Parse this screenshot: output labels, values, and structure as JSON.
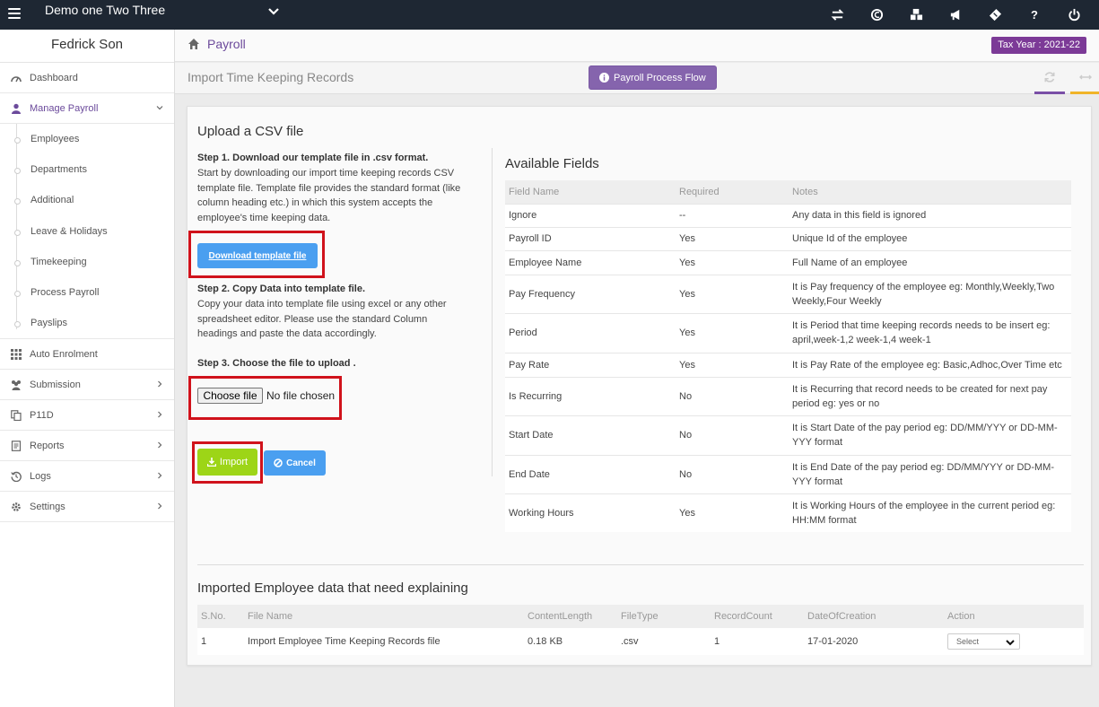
{
  "app": {
    "company": "Demo one Two Three"
  },
  "sidebar": {
    "user": "Fedrick Son",
    "items": [
      {
        "label": "Dashboard",
        "icon": "dashboard-icon"
      },
      {
        "label": "Manage Payroll",
        "icon": "user-icon"
      },
      {
        "label": "Auto Enrolment",
        "icon": "grid-icon"
      },
      {
        "label": "Submission",
        "icon": "users-icon"
      },
      {
        "label": "P11D",
        "icon": "copy-icon"
      },
      {
        "label": "Reports",
        "icon": "report-icon"
      },
      {
        "label": "Logs",
        "icon": "history-icon"
      },
      {
        "label": "Settings",
        "icon": "gear-icon"
      }
    ],
    "sub_items": [
      "Employees",
      "Departments",
      "Additional",
      "Leave & Holidays",
      "Timekeeping",
      "Process Payroll",
      "Payslips"
    ]
  },
  "header": {
    "breadcrumb": "Payroll",
    "tax_year": "Tax Year : 2021-22",
    "page_title": "Import Time Keeping Records",
    "flow_button": "Payroll Process Flow"
  },
  "upload": {
    "title": "Upload a CSV file",
    "step1_title": "Step 1. Download our template file in .csv format.",
    "step1_text": "Start by downloading our import time keeping records CSV template file. Template file provides the standard format (like column heading etc.) in which this system accepts the employee's time keeping data.",
    "download_button": "Download template file",
    "step2_title": "Step 2. Copy Data into template file.",
    "step2_text": "Copy your data into template file using excel or any other spreadsheet editor. Please use the standard Column headings and paste the data accordingly.",
    "step3_title": "Step 3. Choose the file to upload .",
    "choose_file": "Choose file",
    "no_file": "No file chosen",
    "import_button": "Import",
    "cancel_button": "Cancel"
  },
  "fields": {
    "title": "Available Fields",
    "headers": [
      "Field Name",
      "Required",
      "Notes"
    ],
    "rows": [
      {
        "name": "Ignore",
        "required": "--",
        "notes": "Any data in this field is ignored"
      },
      {
        "name": "Payroll ID",
        "required": "Yes",
        "notes": "Unique Id of the employee"
      },
      {
        "name": "Employee Name",
        "required": "Yes",
        "notes": "Full Name of an employee"
      },
      {
        "name": "Pay Frequency",
        "required": "Yes",
        "notes": "It is Pay frequency of the employee eg: Monthly,Weekly,Two Weekly,Four Weekly"
      },
      {
        "name": "Period",
        "required": "Yes",
        "notes": "It is Period that time keeping records needs to be insert eg: april,week-1,2 week-1,4 week-1"
      },
      {
        "name": "Pay Rate",
        "required": "Yes",
        "notes": "It is Pay Rate of the employee eg: Basic,Adhoc,Over Time etc"
      },
      {
        "name": "Is Recurring",
        "required": "No",
        "notes": "It is Recurring that record needs to be created for next pay period eg: yes or no"
      },
      {
        "name": "Start Date",
        "required": "No",
        "notes": "It is Start Date of the pay period eg: DD/MM/YYY or DD-MM-YYY format"
      },
      {
        "name": "End Date",
        "required": "No",
        "notes": "It is End Date of the pay period eg: DD/MM/YYY or DD-MM-YYY format"
      },
      {
        "name": "Working Hours",
        "required": "Yes",
        "notes": "It is Working Hours of the employee in the current period eg: HH:MM format"
      }
    ]
  },
  "imported": {
    "title": "Imported Employee data that need explaining",
    "headers": [
      "S.No.",
      "File Name",
      "ContentLength",
      "FileType",
      "RecordCount",
      "DateOfCreation",
      "Action"
    ],
    "rows": [
      {
        "sno": "1",
        "file_name": "Import Employee Time Keeping Records file",
        "length": "0.18 KB",
        "type": ".csv",
        "count": "1",
        "date": "17-01-2020",
        "action": "Select"
      }
    ]
  },
  "colors": {
    "topbar": "#1e2733",
    "accent_purple": "#8564ad",
    "badge_purple": "#7c3a97",
    "button_blue": "#4a9ff0",
    "import_green": "#9dd517",
    "highlight_red": "#d0121b"
  }
}
